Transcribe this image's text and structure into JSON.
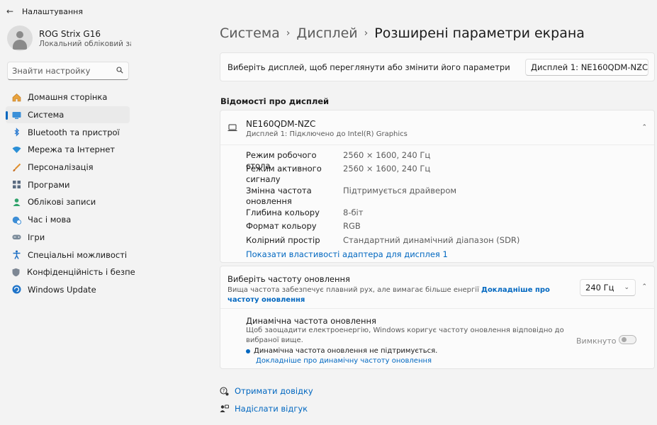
{
  "app": {
    "title": "Налаштування"
  },
  "profile": {
    "name": "ROG Strix G16",
    "account": "Локальний обліковий за..."
  },
  "search": {
    "placeholder": "Знайти настройку"
  },
  "sidebar": {
    "items": [
      {
        "label": "Домашня сторінка",
        "icon": "home-icon"
      },
      {
        "label": "Система",
        "icon": "system-icon",
        "active": true
      },
      {
        "label": "Bluetooth та пристрої",
        "icon": "bluetooth-icon"
      },
      {
        "label": "Мережа та Інтернет",
        "icon": "wifi-icon"
      },
      {
        "label": "Персоналізація",
        "icon": "brush-icon"
      },
      {
        "label": "Програми",
        "icon": "apps-icon"
      },
      {
        "label": "Облікові записи",
        "icon": "person-icon"
      },
      {
        "label": "Час і мова",
        "icon": "globe-clock-icon"
      },
      {
        "label": "Ігри",
        "icon": "gamepad-icon"
      },
      {
        "label": "Спеціальні можливості",
        "icon": "accessibility-icon"
      },
      {
        "label": "Конфіденційність і безпе",
        "icon": "shield-icon"
      },
      {
        "label": "Windows Update",
        "icon": "update-icon"
      }
    ]
  },
  "breadcrumb": {
    "level1": "Система",
    "level2": "Дисплей",
    "current": "Розширені параметри екрана"
  },
  "choose_display": {
    "label": "Виберіть дисплей, щоб переглянути або змінити його параметри",
    "selected": "Дисплей 1: NE160QDM-NZC"
  },
  "display_info": {
    "section_title": "Відомості про дисплей",
    "name": "NE160QDM-NZC",
    "subtitle": "Дисплей 1: Підключено до Intel(R) Graphics",
    "properties": [
      {
        "label": "Режим робочого стола",
        "value": "2560 × 1600, 240 Гц"
      },
      {
        "label": "Режим активного сигналу",
        "value": "2560 × 1600, 240 Гц"
      },
      {
        "label": "Змінна частота оновлення",
        "value": "Підтримується драйвером"
      },
      {
        "label": "Глибина кольору",
        "value": "8-біт"
      },
      {
        "label": "Формат кольору",
        "value": "RGB"
      },
      {
        "label": "Колірний простір",
        "value": "Стандартний динамічний діапазон (SDR)"
      }
    ],
    "adapter_link": "Показати властивості адаптера для дисплея 1"
  },
  "refresh": {
    "title": "Виберіть частоту оновлення",
    "desc": "Вища частота забезпечує плавний рух, але вимагає більше енергії",
    "more_link": "Докладніше про частоту оновлення",
    "selected": "240 Гц",
    "dynamic": {
      "title": "Динамічна частота оновлення",
      "desc": "Щоб заощадити електроенергію, Windows коригує частоту оновлення відповідно до вибраної вище.",
      "note": "Динамічна частота оновлення не підтримується.",
      "link": "Докладніше про динамічну частоту оновлення",
      "toggle_label": "Вимкнуто",
      "toggle_on": false
    }
  },
  "footer": {
    "help": "Отримати довідку",
    "feedback": "Надіслати відгук"
  },
  "colors": {
    "accent": "#0067c0",
    "background": "#f3f3f3",
    "card": "#fbfbfb"
  }
}
